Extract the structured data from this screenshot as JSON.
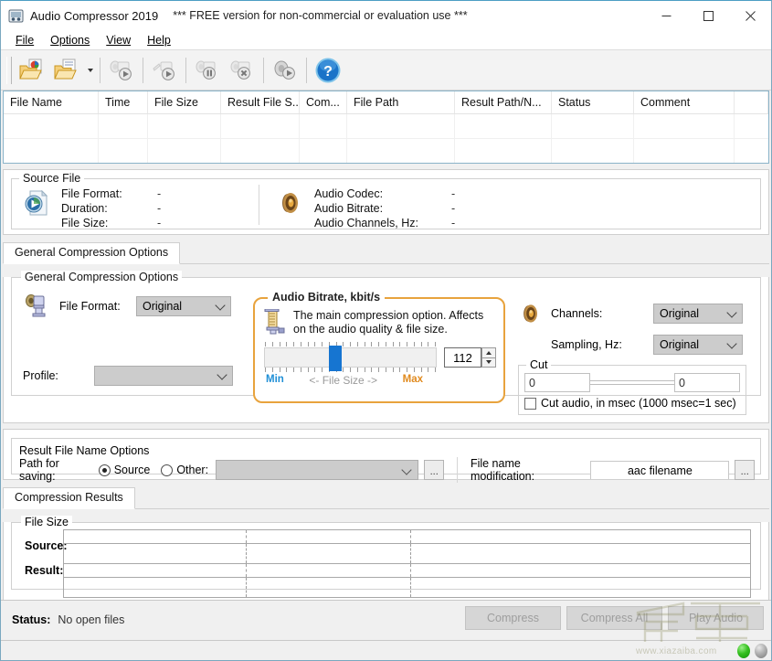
{
  "window": {
    "title": "Audio Compressor 2019",
    "subtitle": "*** FREE version for non-commercial or evaluation use ***",
    "icon": "app-icon",
    "minimize_label": "Minimize",
    "maximize_label": "Maximize",
    "close_label": "Close"
  },
  "menu": {
    "items": [
      {
        "label": "File",
        "accel": "F"
      },
      {
        "label": "Options",
        "accel": "O"
      },
      {
        "label": "View",
        "accel": "V"
      },
      {
        "label": "Help",
        "accel": "H"
      }
    ]
  },
  "toolbar": {
    "buttons": [
      {
        "name": "open-file-icon",
        "tooltip": "Open file"
      },
      {
        "name": "open-folder-icon",
        "tooltip": "Open folder"
      },
      {
        "name": "compress-icon",
        "tooltip": "Compress"
      },
      {
        "name": "compress-all-icon",
        "tooltip": "Compress all"
      },
      {
        "name": "pause-icon",
        "tooltip": "Pause"
      },
      {
        "name": "stop-icon",
        "tooltip": "Stop"
      },
      {
        "name": "play-audio-icon",
        "tooltip": "Play audio"
      },
      {
        "name": "help-icon",
        "tooltip": "Help"
      }
    ]
  },
  "file_list": {
    "columns": [
      {
        "label": "File Name",
        "width": 104
      },
      {
        "label": "Time",
        "width": 54
      },
      {
        "label": "File Size",
        "width": 80
      },
      {
        "label": "Result File S...",
        "width": 86
      },
      {
        "label": "Com...",
        "width": 52
      },
      {
        "label": "File Path",
        "width": 118
      },
      {
        "label": "Result Path/N...",
        "width": 106
      },
      {
        "label": "Status",
        "width": 90
      },
      {
        "label": "Comment",
        "width": 110
      }
    ],
    "rows": []
  },
  "source_file": {
    "group_title": "Source File",
    "left_icon": "audio-file-icon",
    "right_icon": "speaker-icon",
    "left_rows": [
      {
        "label": "File Format:",
        "value": "-"
      },
      {
        "label": "Duration:",
        "value": "-"
      },
      {
        "label": "File Size:",
        "value": "-"
      }
    ],
    "right_rows": [
      {
        "label": "Audio Codec:",
        "value": "-"
      },
      {
        "label": "Audio Bitrate:",
        "value": "-"
      },
      {
        "label": "Audio Channels, Hz:",
        "value": "-"
      }
    ]
  },
  "options_tab": {
    "tab_label": "General Compression Options",
    "group_title": "General Compression Options",
    "file_format": {
      "icon": "compressor-icon",
      "label": "File Format:",
      "value": "Original",
      "options": [
        "Original"
      ]
    },
    "profile": {
      "label": "Profile:",
      "value": "",
      "options": []
    },
    "bitrate": {
      "group_title": "Audio Bitrate, kbit/s",
      "icon": "bitrate-meter-icon",
      "description": "The main compression option. Affects on the audio quality & file size.",
      "value": "112",
      "min_label": "Min",
      "max_label": "Max",
      "middle_label": "<-  File Size  ->",
      "slider_percent": 37,
      "accent_color": "#e8a33d",
      "thumb_color": "#1675d1",
      "min_color": "#1f8fd6",
      "max_color": "#e08a1e"
    },
    "channels": {
      "icon": "speaker-icon",
      "label": "Channels:",
      "value": "Original",
      "options": [
        "Original"
      ]
    },
    "sampling": {
      "label": "Sampling, Hz:",
      "value": "Original",
      "options": [
        "Original"
      ]
    },
    "cut": {
      "group_title": "Cut",
      "start_value": "0",
      "end_value": "0",
      "checkbox_label": "Cut audio, in msec (1000 msec=1 sec)",
      "checked": false
    }
  },
  "result_file_name": {
    "group_title": "Result File Name Options",
    "path_label": "Path for saving:",
    "source_option": "Source",
    "other_option": "Other:",
    "selected": "Source",
    "other_path_value": "",
    "browse_label": "...",
    "modification_label": "File name modification:",
    "modification_value": "aac  filename",
    "modification_browse_label": "..."
  },
  "compression_results": {
    "tab_label": "Compression Results",
    "group_title": "File Size",
    "rows": [
      {
        "label": "Source:",
        "cells": [
          "",
          "",
          ""
        ]
      },
      {
        "label": "Result:",
        "cells": [
          "",
          "",
          ""
        ]
      }
    ]
  },
  "status_bar": {
    "label": "Status:",
    "text": "No open files",
    "buttons": [
      {
        "name": "compress-button",
        "label": "Compress",
        "enabled": false
      },
      {
        "name": "compress-all-button",
        "label": "Compress All",
        "enabled": false
      },
      {
        "name": "play-audio-button",
        "label": "Play Audio",
        "enabled": false
      }
    ],
    "leds": [
      "green-led",
      "grey-led"
    ]
  },
  "watermark": {
    "text": "www.xiazaiba.com"
  }
}
